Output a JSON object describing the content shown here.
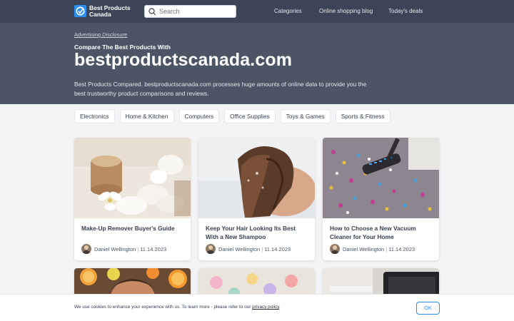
{
  "brand": {
    "name_line1": "Best Products",
    "name_line2": "Canada"
  },
  "search": {
    "placeholder": "Search"
  },
  "nav": {
    "categories": "Categories",
    "blog": "Online shopping blog",
    "deals": "Today's deals"
  },
  "hero": {
    "disclosure": "Advertising Disclosure",
    "eyebrow": "Compare The Best Products With",
    "title": "bestproductscanada.com",
    "description": "Best Products Compared. bestproductscanada.com processes huge amounts of online data to provide you the best trustworthy product comparisons and reviews."
  },
  "categories": [
    "Electronics",
    "Home & Kitchen",
    "Computers",
    "Office Supplies",
    "Toys & Games",
    "Sports & Fitness"
  ],
  "articles": [
    {
      "title": "Make-Up Remover Buyer's Guide",
      "author": "Daniel Wellington",
      "date": "11.14.2023"
    },
    {
      "title": "Keep Your Hair Looking Its Best With a New Shampoo",
      "author": "Daniel Wellington",
      "date": "11.14.2023"
    },
    {
      "title": "How to Choose a New Vacuum Cleaner for Your Home",
      "author": "Daniel Wellington",
      "date": "11.14.2023"
    }
  ],
  "cookie": {
    "text": "We use cookies to enhance your experience with us. To learn more - please refer to our ",
    "link": "privacy policy",
    "end": ".",
    "ok": "OK"
  },
  "colors": {
    "nav_bg": "#3b4557",
    "hero_bg": "#4b5565",
    "accent": "#2f8ff0",
    "page_bg": "#f3f4f6"
  },
  "icons": {
    "search": "search-icon",
    "logo": "logo-icon"
  }
}
